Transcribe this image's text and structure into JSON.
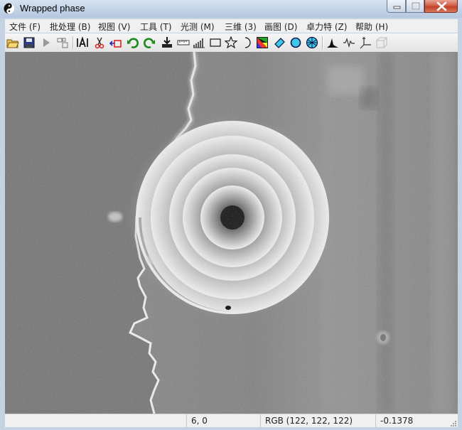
{
  "window": {
    "title": "Wrapped phase"
  },
  "menu": [
    {
      "label": "文件 (F)"
    },
    {
      "label": "批处理 (B)"
    },
    {
      "label": "视图 (V)"
    },
    {
      "label": "工具 (T)"
    },
    {
      "label": "光测 (M)"
    },
    {
      "label": "三维 (3)"
    },
    {
      "label": "画图 (D)"
    },
    {
      "label": "卓力特 (Z)"
    },
    {
      "label": "帮助 (H)"
    }
  ],
  "toolbar": [
    "open-folder-icon",
    "save-icon",
    "run-icon",
    "layout-icon",
    "text-tool-icon",
    "cut-icon",
    "crop-icon",
    "undo-icon",
    "redo-icon",
    "download-icon",
    "ruler-icon",
    "histogram-bars-icon",
    "rectangle-icon",
    "star-icon",
    "moon-icon",
    "colormap-icon",
    "eraser-icon",
    "circle-icon",
    "mesh-icon",
    "peak-icon",
    "wave-icon",
    "axes-icon",
    "cube-icon"
  ],
  "status": {
    "coords": "6, 0",
    "rgb": "RGB (122, 122, 122)",
    "value": "-0.1378"
  },
  "image": {
    "description_colors": {
      "background": "#6d6d6d",
      "fringe_dark": "#0a0a0a",
      "fringe_light": "#f4f4f4"
    },
    "rings": 5
  }
}
